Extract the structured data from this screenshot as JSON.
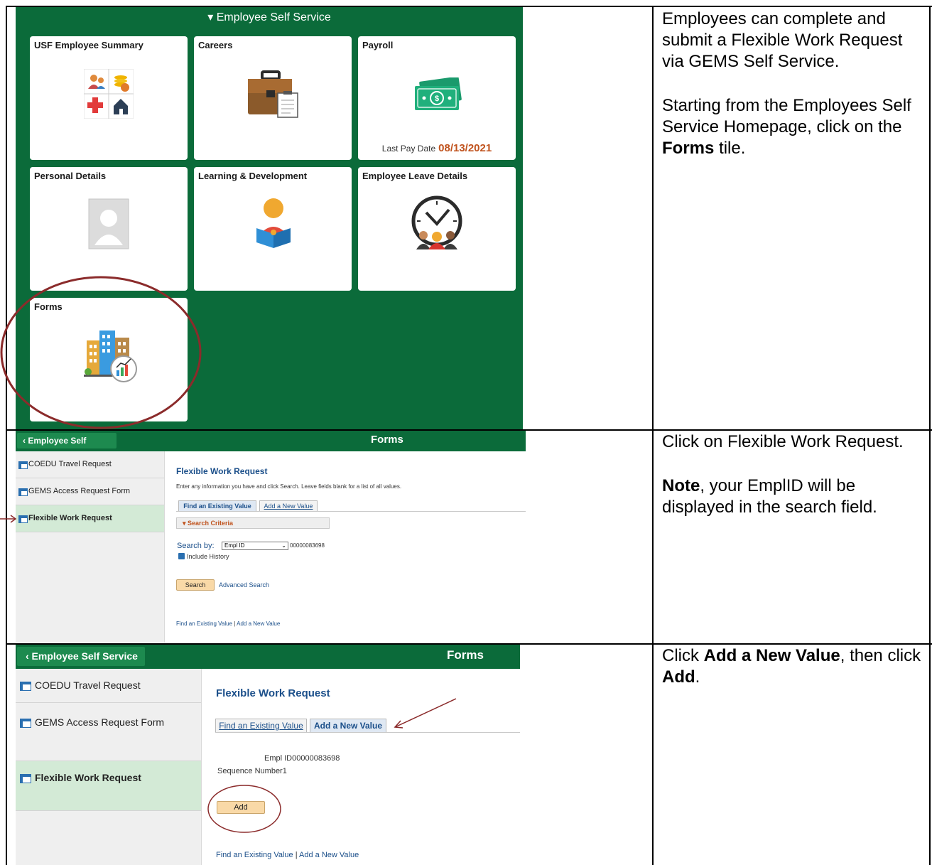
{
  "instructions": {
    "row1": {
      "p1": "Employees can complete and submit a Flexible Work Request via GEMS Self Service.",
      "p2_pre": "Starting from the Employees Self Service Homepage, click on the ",
      "p2_bold": "Forms",
      "p2_post": " tile."
    },
    "row2": {
      "p1": "Click on Flexible Work Request.",
      "p2_bold": "Note",
      "p2_post": ", your EmplID will be displayed in the search field."
    },
    "row3": {
      "pre": "Click ",
      "bold1": "Add a New Value",
      "mid": ", then click ",
      "bold2": "Add",
      "post": "."
    }
  },
  "homepage": {
    "title": "▾ Employee Self Service",
    "tiles": {
      "usf_summary": "USF Employee Summary",
      "careers": "Careers",
      "payroll": "Payroll",
      "payroll_last_pay_label": "Last Pay Date",
      "payroll_last_pay_date": "08/13/2021",
      "personal_details": "Personal Details",
      "learning": "Learning & Development",
      "leave": "Employee Leave Details",
      "forms": "Forms"
    }
  },
  "forms_search": {
    "back_label": "‹ Employee Self Service",
    "header_title": "Forms",
    "sidebar": [
      "COEDU Travel Request",
      "GEMS Access Request Form",
      "Flexible Work Request"
    ],
    "page_title": "Flexible Work Request",
    "help_text": "Enter any information you have and click Search. Leave fields blank for a list of all values.",
    "tab_find": "Find an Existing Value",
    "tab_add": "Add a New Value",
    "criteria_label": "▾ Search Criteria",
    "search_by_label": "Search by:",
    "search_by_value": "Empl ID",
    "search_value": "00000083698",
    "include_history": "Include History",
    "search_button": "Search",
    "advanced_search": "Advanced Search",
    "footer_find": "Find an Existing Value",
    "footer_sep": "|",
    "footer_add": "Add a New Value"
  },
  "forms_add": {
    "back_label": "‹ Employee Self Service",
    "header_title": "Forms",
    "sidebar": [
      "COEDU Travel Request",
      "GEMS Access Request Form",
      "Flexible Work Request"
    ],
    "page_title": "Flexible Work Request",
    "tab_find": "Find an Existing Value",
    "tab_add": "Add a New Value",
    "empl_id_label": "Empl ID",
    "empl_id_value": "00000083698",
    "seq_label": "Sequence Number",
    "seq_value": "1",
    "add_button": "Add",
    "footer_find": "Find an Existing Value",
    "footer_sep": "|",
    "footer_add": "Add a New Value"
  },
  "colors": {
    "fluid_green": "#0b6b3a",
    "selected_row": "#d3ead6",
    "annotation": "#8b2b2b",
    "pay_date": "#c0531e"
  }
}
